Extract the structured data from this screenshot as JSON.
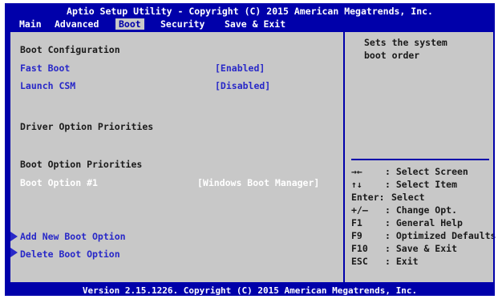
{
  "title": "Aptio Setup Utility - Copyright (C) 2015 American Megatrends, Inc.",
  "menu": {
    "main": "Main",
    "advanced": "Advanced",
    "boot": "Boot",
    "security": "Security",
    "save_exit": "Save & Exit"
  },
  "left": {
    "boot_config": "Boot Configuration",
    "fast_boot": {
      "label": "Fast Boot",
      "value": "[Enabled]"
    },
    "launch_csm": {
      "label": "Launch CSM",
      "value": "[Disabled]"
    },
    "driver_priorities": "Driver Option Priorities",
    "boot_priorities": "Boot Option Priorities",
    "boot_option_1": {
      "label": "Boot Option #1",
      "value": "[Windows Boot Manager]"
    },
    "add_boot_option": "Add New Boot Option",
    "delete_boot_option": "Delete Boot Option"
  },
  "help": {
    "line1": "Sets the system",
    "line2": "boot order"
  },
  "keys": [
    {
      "key": "→←",
      "desc": ": Select Screen"
    },
    {
      "key": "↑↓",
      "desc": ": Select Item"
    },
    {
      "key": "Enter:",
      "desc": "Select"
    },
    {
      "key": "+/—",
      "desc": ": Change Opt."
    },
    {
      "key": "F1",
      "desc": ": General Help"
    },
    {
      "key": "F9",
      "desc": ": Optimized Defaults"
    },
    {
      "key": "F10",
      "desc": ": Save & Exit"
    },
    {
      "key": "ESC",
      "desc": ": Exit"
    }
  ],
  "footer": "Version 2.15.1226. Copyright (C) 2015 American Megatrends, Inc.",
  "colors": {
    "background": "#0000aa",
    "panel": "#c8c8c8",
    "item_blue": "#2828c8",
    "selected_text": "#ffffff"
  }
}
